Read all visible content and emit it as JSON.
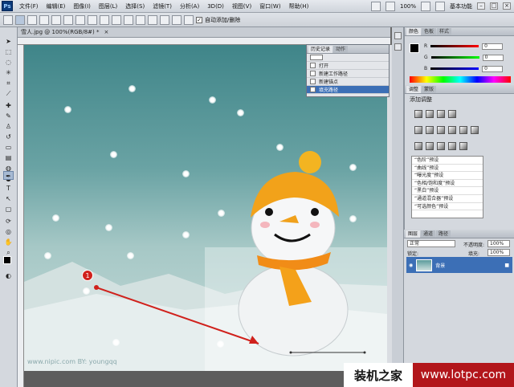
{
  "menubar": {
    "logo": "Ps",
    "items": [
      "文件(F)",
      "编辑(E)",
      "图像(I)",
      "图层(L)",
      "选择(S)",
      "滤镜(T)",
      "分析(A)",
      "3D(D)",
      "视图(V)",
      "窗口(W)",
      "帮助(H)"
    ],
    "zoom": "100%",
    "workspace": "基本功能"
  },
  "options": {
    "autoselect_label": "自动添加/删除"
  },
  "document": {
    "tab_title": "雪人.jpg @ 100%(RGB/8#) *",
    "watermark": "www.nipic.com    BY: youngqq"
  },
  "history_panel": {
    "tabs": [
      "历史记录",
      "动作"
    ],
    "entries": [
      "打开",
      "新建工作路径",
      "新建锚点",
      "填充路径"
    ],
    "selected_index": 3
  },
  "color_panel": {
    "tabs": [
      "颜色",
      "色板",
      "样式"
    ],
    "channels": [
      {
        "label": "R",
        "value": "0"
      },
      {
        "label": "G",
        "value": "0"
      },
      {
        "label": "B",
        "value": "0"
      }
    ]
  },
  "adjustments_panel": {
    "tabs": [
      "调整",
      "蒙版"
    ],
    "title": "添加调整",
    "presets": [
      "“色阶”预设",
      "“曲线”预设",
      "“曝光度”预设",
      "“色相/饱和度”预设",
      "“黑白”预设",
      "“通道混合器”预设",
      "“可选颜色”预设"
    ]
  },
  "layers_panel": {
    "tabs": [
      "图层",
      "通道",
      "路径"
    ],
    "blend_mode": "正常",
    "opacity_label": "不透明度:",
    "opacity": "100%",
    "lock_label": "锁定:",
    "fill_label": "填充:",
    "fill": "100%",
    "layer_name": "背景"
  },
  "annotation": {
    "marker": "1",
    "arrow_color": "#d0211c"
  },
  "credit": {
    "cn": "装机之家",
    "url": "www.lotpc.com"
  },
  "colors": {
    "selection_blue": "#3c6fb6",
    "credit_red": "#b2161b"
  }
}
